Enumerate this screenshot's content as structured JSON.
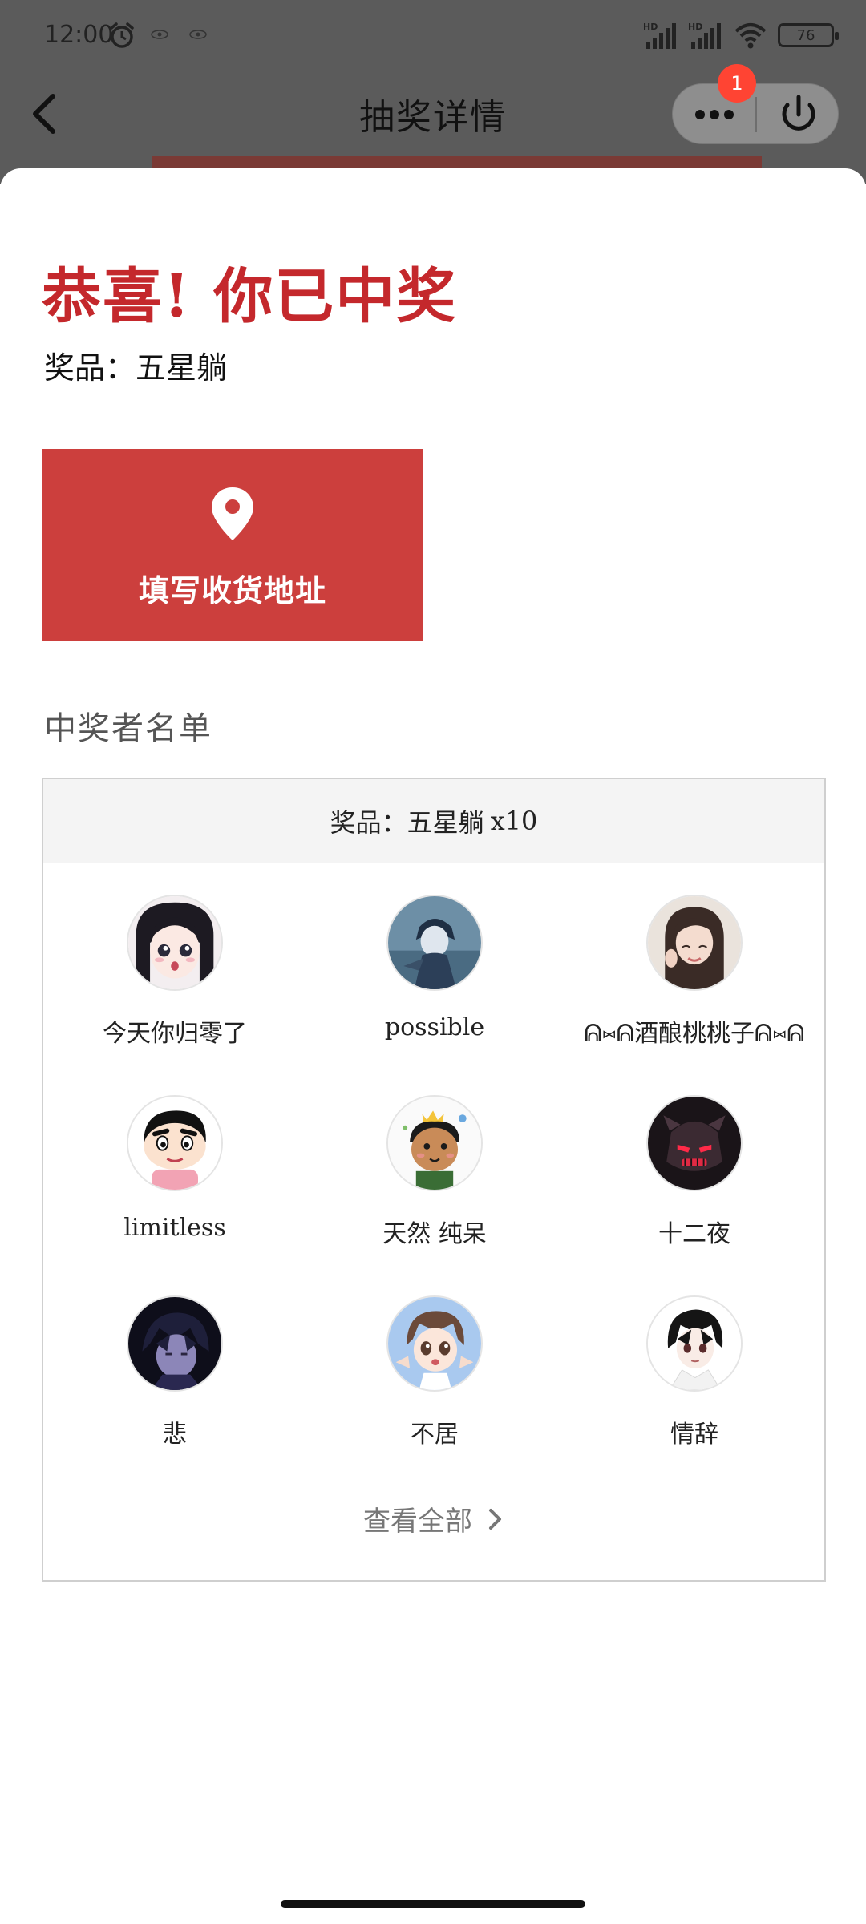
{
  "status_bar": {
    "time": "12:00",
    "battery": "76"
  },
  "nav": {
    "title": "抽奖详情",
    "badge_count": "1"
  },
  "result": {
    "headline": "恭喜! 你已中奖",
    "prize_label": "奖品：五星躺"
  },
  "address_button": {
    "label": "填写收货地址"
  },
  "winners": {
    "section_title": "中奖者名单",
    "header_prize": "奖品：五星躺",
    "header_count": "x10",
    "list": [
      {
        "name": "今天你归零了",
        "avatar": "anime-girl-avatar"
      },
      {
        "name": "possible",
        "avatar": "anime-boy-blue-avatar"
      },
      {
        "name": "ᕱ⑅ᕱ酒酿桃桃子ᕱ⑅ᕱ",
        "avatar": "girl-photo-avatar"
      },
      {
        "name": "limitless",
        "avatar": "crayon-shinchan-avatar"
      },
      {
        "name": "天然 纯呆",
        "avatar": "cartoon-boy-crown-avatar"
      },
      {
        "name": "十二夜",
        "avatar": "robot-mask-avatar"
      },
      {
        "name": "悲",
        "avatar": "dark-anime-avatar"
      },
      {
        "name": "不居",
        "avatar": "anime-kid-avatar"
      },
      {
        "name": "情辞",
        "avatar": "anime-black-hair-avatar"
      }
    ],
    "view_all": "查看全部"
  },
  "colors": {
    "accent_red": "#c4282c",
    "button_red": "#cc3f3d",
    "badge_red": "#ff4433"
  }
}
